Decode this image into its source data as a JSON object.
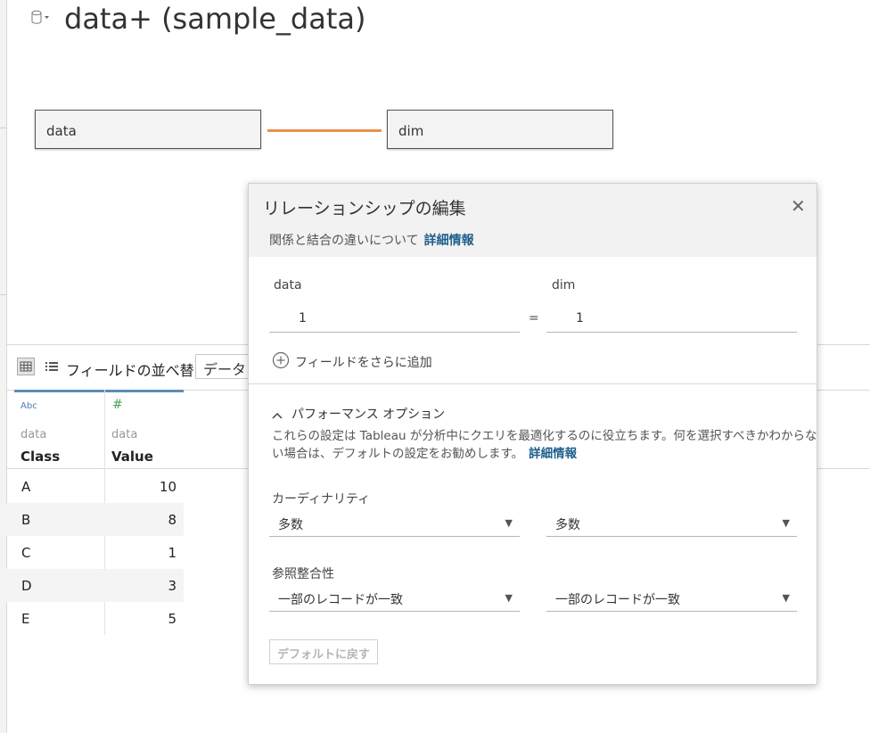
{
  "page": {
    "title": "data+ (sample_data)"
  },
  "canvas": {
    "left_table": "data",
    "right_table": "dim",
    "relation_color": "#e8924a"
  },
  "toolbar": {
    "sort_label": "フィールドの並べ替え",
    "sort_value": "データソ"
  },
  "grid": {
    "columns": [
      {
        "type_icon": "Abc",
        "source": "data",
        "field": "Class"
      },
      {
        "type_icon": "#",
        "source": "data",
        "field": "Value"
      }
    ],
    "rows": [
      {
        "class": "A",
        "value": "10"
      },
      {
        "class": "B",
        "value": "8"
      },
      {
        "class": "C",
        "value": "1"
      },
      {
        "class": "D",
        "value": "3"
      },
      {
        "class": "E",
        "value": "5"
      }
    ]
  },
  "dialog": {
    "title": "リレーションシップの編集",
    "subtitle": "関係と結合の違いについて",
    "subtitle_link": "詳細情報",
    "left_table": "data",
    "right_table": "dim",
    "left_field": "1",
    "operator": "=",
    "right_field": "1",
    "add_field": "フィールドをさらに追加",
    "perf_toggle": "パフォーマンス オプション",
    "perf_desc_1": "これらの設定は Tableau が分析中にクエリを最適化するのに役立ちます。何を選択すべきかわからな",
    "perf_desc_2": "い場合は、デフォルトの設定をお勧めします。",
    "perf_link": "詳細情報",
    "cardinality_label": "カーディナリティ",
    "cardinality_left": "多数",
    "cardinality_right": "多数",
    "integrity_label": "参照整合性",
    "integrity_left": "一部のレコードが一致",
    "integrity_right": "一部のレコードが一致",
    "reset_button": "デフォルトに戻す"
  }
}
